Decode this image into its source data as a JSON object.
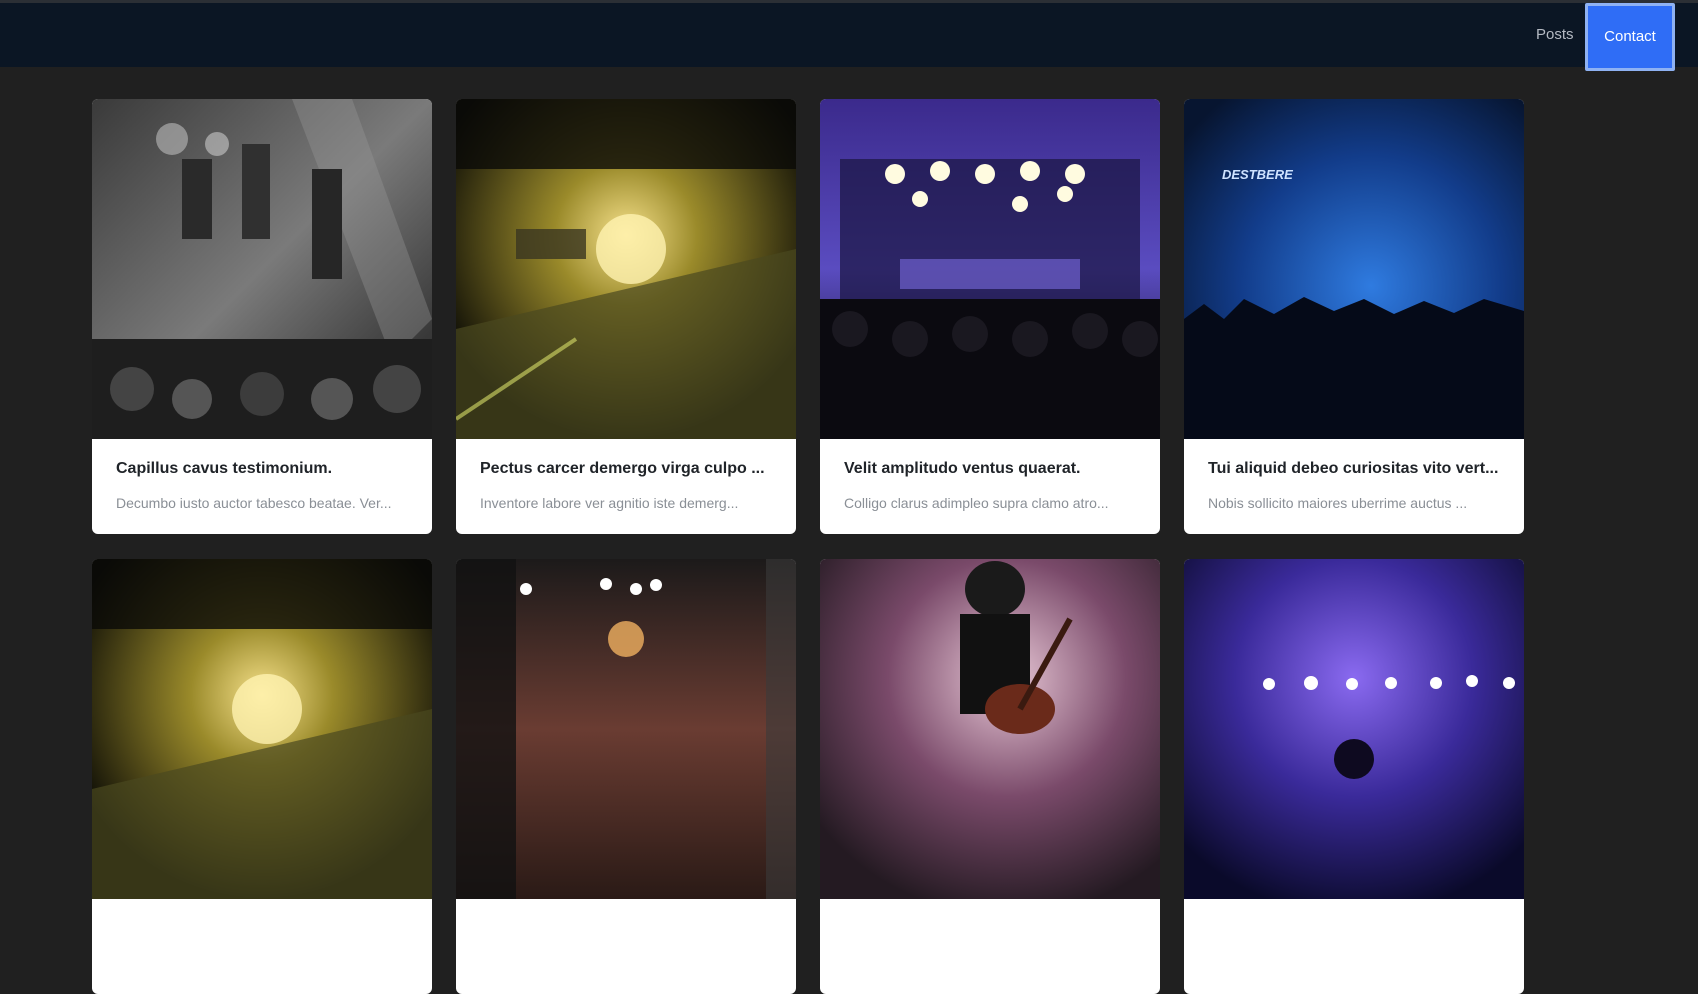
{
  "nav": {
    "posts_label": "Posts",
    "contact_label": "Contact"
  },
  "posts": [
    {
      "title": "Capillus cavus testimonium.",
      "excerpt": "Decumbo iusto auctor tabesco beatae. Ver...",
      "image_text": ""
    },
    {
      "title": "Pectus carcer demergo virga culpo ...",
      "excerpt": "Inventore labore ver agnitio iste demerg...",
      "image_text": ""
    },
    {
      "title": "Velit amplitudo ventus quaerat.",
      "excerpt": "Colligo clarus adimpleo supra clamo atro...",
      "image_text": ""
    },
    {
      "title": "Tui aliquid debeo curiositas vito vert...",
      "excerpt": "Nobis sollicito maiores uberrime auctus ...",
      "image_text": "DESTBERE"
    },
    {
      "title": "",
      "excerpt": "",
      "image_text": ""
    },
    {
      "title": "",
      "excerpt": "",
      "image_text": ""
    },
    {
      "title": "",
      "excerpt": "",
      "image_text": ""
    },
    {
      "title": "",
      "excerpt": "",
      "image_text": ""
    }
  ]
}
